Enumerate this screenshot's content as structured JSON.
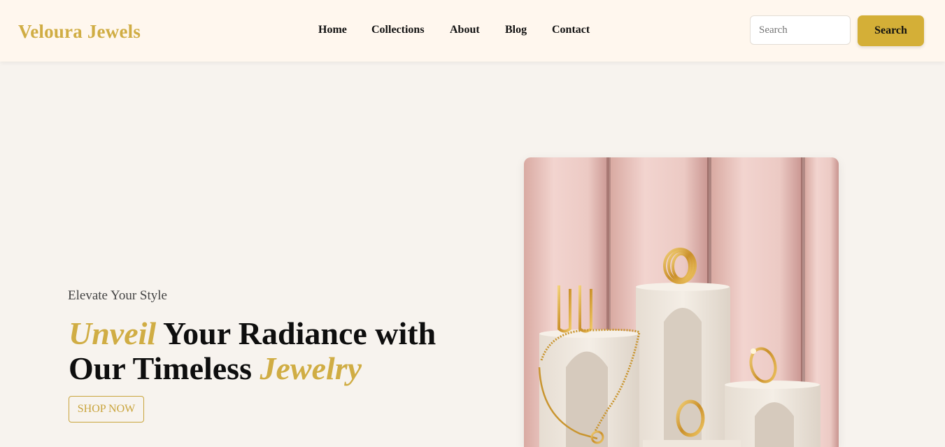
{
  "brand": {
    "name": "Veloura Jewels"
  },
  "nav": {
    "items": [
      {
        "label": "Home"
      },
      {
        "label": "Collections"
      },
      {
        "label": "About"
      },
      {
        "label": "Blog"
      },
      {
        "label": "Contact"
      }
    ]
  },
  "search": {
    "placeholder": "Search",
    "value": "",
    "button_label": "Search"
  },
  "hero": {
    "eyebrow": "Elevate Your Style",
    "headline": {
      "accent_1": "Unveil",
      "mid": " Your Radiance with Our Timeless ",
      "accent_2": "Jewelry"
    },
    "cta_label": "SHOP NOW"
  },
  "colors": {
    "brand_gold": "#d0ad44",
    "button_gold": "#d4af37",
    "page_background": "#f7f3ee",
    "navbar_background": "#fff7ee"
  }
}
